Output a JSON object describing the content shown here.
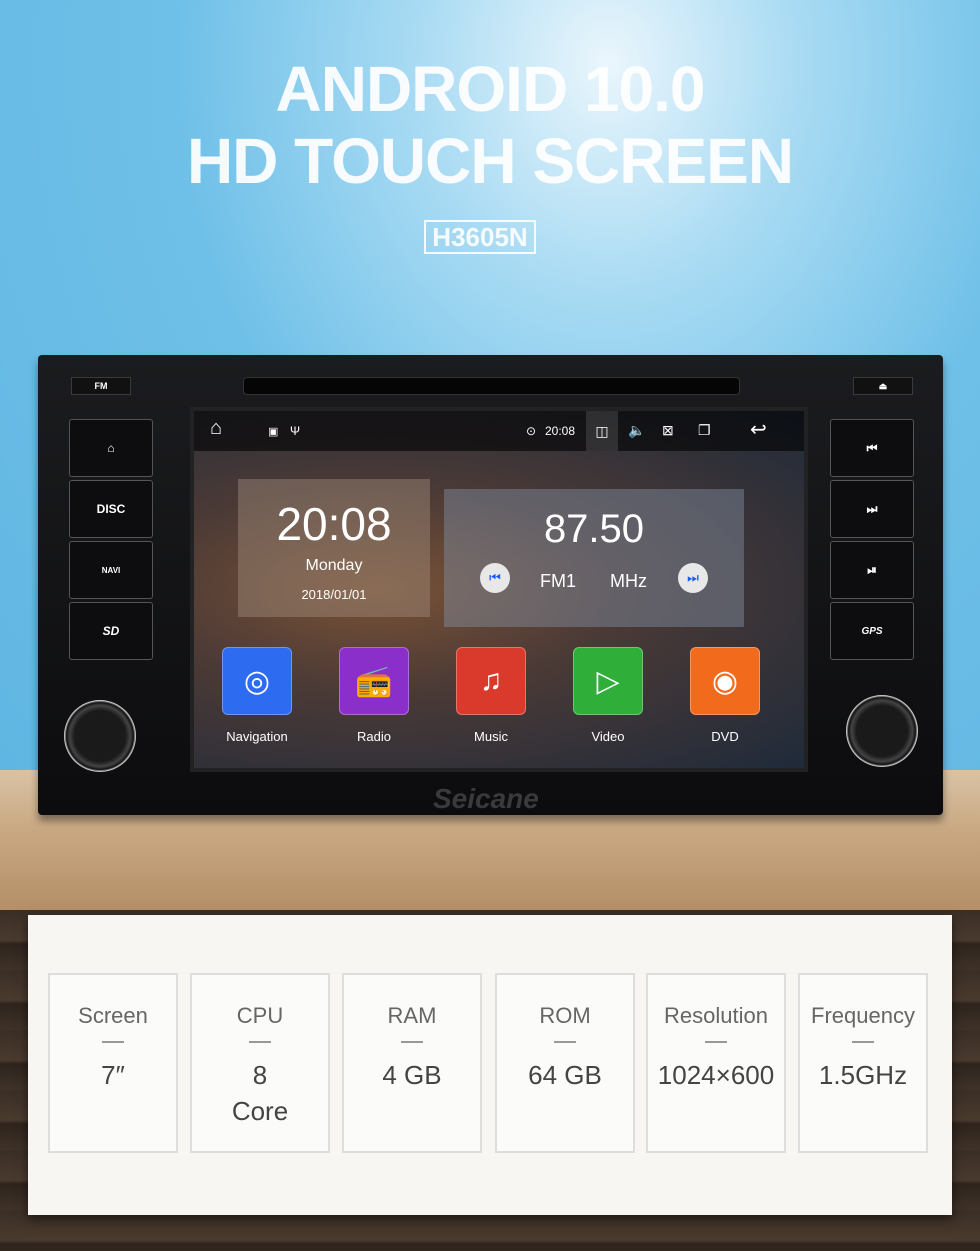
{
  "headline": {
    "line1": "ANDROID 10.0",
    "line2": "HD TOUCH SCREEN",
    "model": "H3605N"
  },
  "device": {
    "brand": "Seicane",
    "top_buttons": {
      "left": "FM",
      "right": "⏏"
    },
    "left_buttons": [
      {
        "label": "⌂",
        "icon": "home-icon"
      },
      {
        "label": "DISC"
      },
      {
        "label": "NAVI",
        "icon": "navi-icon"
      },
      {
        "label": "SD",
        "icon": "sd-icon"
      }
    ],
    "right_buttons": [
      {
        "label": "⏮",
        "icon": "previous-track-icon"
      },
      {
        "label": "⏭",
        "icon": "next-track-icon"
      },
      {
        "label": "⏯",
        "icon": "play-pause-icon"
      },
      {
        "label": "GPS",
        "icon": "gps-icon"
      }
    ],
    "screen": {
      "status": {
        "time": "20:08"
      },
      "clock": {
        "time": "20:08",
        "day": "Monday",
        "date": "2018/01/01"
      },
      "radio": {
        "frequency": "87.50",
        "band": "FM1",
        "unit": "MHz"
      },
      "apps": [
        {
          "label": "Navigation",
          "color": "#2d6bf0",
          "icon": "navigation-icon",
          "glyph": "◎"
        },
        {
          "label": "Radio",
          "color": "#8a2fc9",
          "icon": "radio-icon",
          "glyph": "📻"
        },
        {
          "label": "Music",
          "color": "#d93a2b",
          "icon": "music-icon",
          "glyph": "♫"
        },
        {
          "label": "Video",
          "color": "#2fae3a",
          "icon": "video-icon",
          "glyph": "▷"
        },
        {
          "label": "DVD",
          "color": "#f26a1b",
          "icon": "dvd-icon",
          "glyph": "◉"
        }
      ]
    }
  },
  "specs": [
    {
      "label": "Screen",
      "value": "7″"
    },
    {
      "label": "CPU",
      "value": "8 Core"
    },
    {
      "label": "RAM",
      "value": "4 GB"
    },
    {
      "label": "ROM",
      "value": "64 GB"
    },
    {
      "label": "Resolution",
      "value": "1024×600"
    },
    {
      "label": "Frequency",
      "value": "1.5GHz"
    }
  ]
}
